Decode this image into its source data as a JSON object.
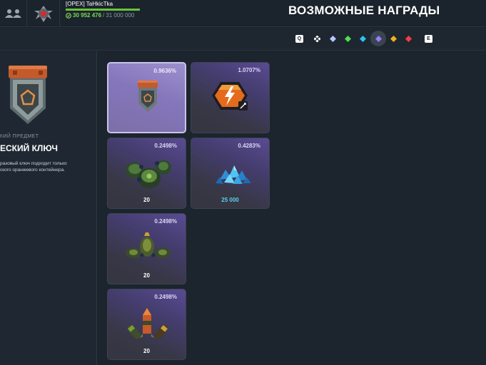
{
  "topbar": {
    "player_name": "[OPEX] TaHkicTka",
    "xp_current": "30 952 476",
    "xp_separator": "/",
    "xp_total": "31 000 000",
    "xp_progress_percent": 99.8,
    "page_title": "ВОЗМОЖНЫЕ НАГРАДЫ"
  },
  "filters": {
    "prev_key": "Q",
    "next_key": "E",
    "gems": [
      {
        "name": "all-rarities",
        "color": "#ffffff"
      },
      {
        "name": "common",
        "color": "#b8c6ff"
      },
      {
        "name": "uncommon",
        "color": "#52e04e"
      },
      {
        "name": "rare",
        "color": "#2bc4f0"
      },
      {
        "name": "epic",
        "color": "#9a7bff"
      },
      {
        "name": "legendary",
        "color": "#f2b21c"
      },
      {
        "name": "exotic",
        "color": "#ff3b46"
      }
    ],
    "active_gem": "epic"
  },
  "selected_item": {
    "category": "КИЙ ПРЕДМЕТ",
    "title": "ЕСКИЙ КЛЮЧ",
    "description_line1": "разовый ключ подходит только",
    "description_line2": "ского оранжевого контейнера."
  },
  "rewards": [
    {
      "chance": "0.9636%",
      "count": "",
      "icon": "orange-container-key-icon",
      "selected": true
    },
    {
      "chance": "1.0707%",
      "count": "",
      "icon": "overdrive-lightning-icon",
      "selected": false
    },
    {
      "chance": "0.2498%",
      "count": "20",
      "icon": "mines-cluster-icon",
      "selected": false
    },
    {
      "chance": "0.4283%",
      "count": "25 000",
      "icon": "crystals-icon",
      "selected": false
    },
    {
      "chance": "0.2498%",
      "count": "20",
      "icon": "grenades-icon",
      "selected": false
    },
    {
      "chance": "0.2498%",
      "count": "20",
      "icon": "rockets-icon",
      "selected": false
    }
  ],
  "colors": {
    "accent_green": "#7ed957",
    "crystal_blue": "#5ecfee",
    "card_purple": "#5a4b93",
    "card_selected": "#8576bb"
  }
}
